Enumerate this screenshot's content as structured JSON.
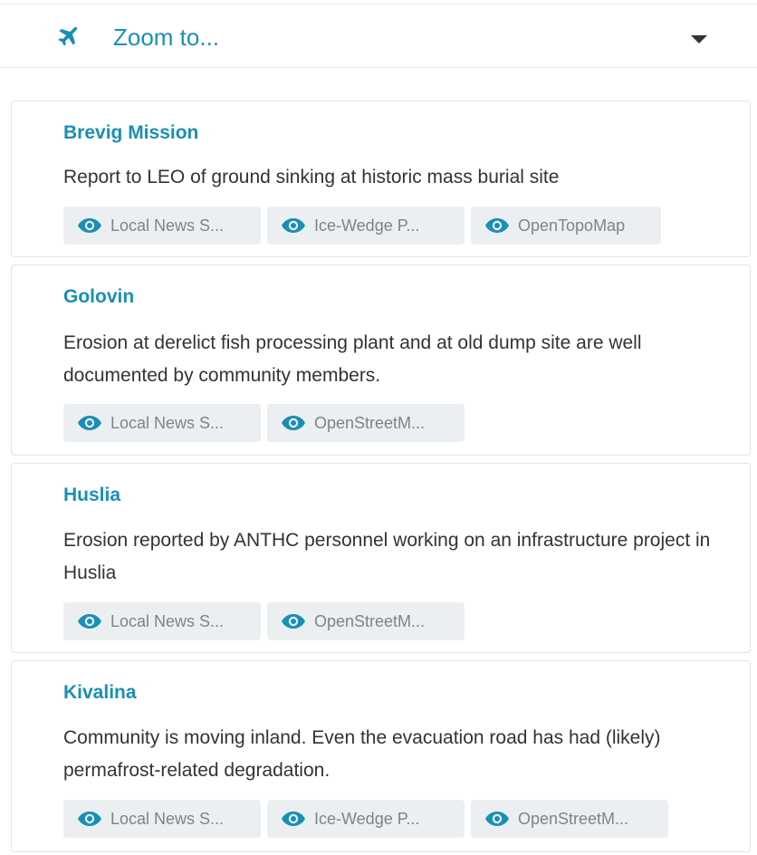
{
  "zoom": {
    "label": "Zoom to...",
    "icon": "plane-icon",
    "caret_icon": "caret-down-icon"
  },
  "colors": {
    "accent": "#1a8fb5",
    "text": "#333333",
    "chip_bg": "#eceff1",
    "chip_text": "#7a858c"
  },
  "cards": [
    {
      "title": "Brevig Mission",
      "description": "Report to LEO of ground sinking at historic mass burial site",
      "chips": [
        "Local News S...",
        "Ice-Wedge P...",
        "OpenTopoMap"
      ]
    },
    {
      "title": "Golovin",
      "description": "Erosion at derelict fish processing plant and at old dump site are well documented by community members.",
      "chips": [
        "Local News S...",
        "OpenStreetM..."
      ]
    },
    {
      "title": "Huslia",
      "description": "Erosion reported by ANTHC personnel working on an infrastructure project in Huslia",
      "chips": [
        "Local News S...",
        "OpenStreetM..."
      ]
    },
    {
      "title": "Kivalina",
      "description": "Community is moving inland. Even the evacuation road has had (likely) permafrost-related degradation.",
      "chips": [
        "Local News S...",
        "Ice-Wedge P...",
        "OpenStreetM..."
      ]
    }
  ]
}
